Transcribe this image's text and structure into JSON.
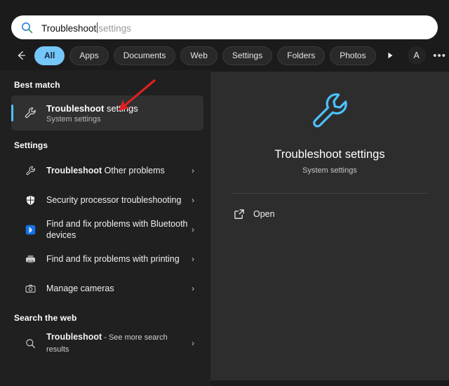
{
  "search": {
    "icon": "search-icon",
    "query": "Troubleshoot",
    "autocomplete_suggestion": "settings",
    "placeholder": "Search"
  },
  "filters": {
    "back_icon": "back-arrow-icon",
    "tabs": [
      {
        "label": "All",
        "active": true
      },
      {
        "label": "Apps",
        "active": false
      },
      {
        "label": "Documents",
        "active": false
      },
      {
        "label": "Web",
        "active": false
      },
      {
        "label": "Settings",
        "active": false
      },
      {
        "label": "Folders",
        "active": false
      },
      {
        "label": "Photos",
        "active": false
      }
    ],
    "more_icon": "play-triangle-icon",
    "account_label": "A",
    "overflow_label": "•••",
    "copilot_icon": "copilot-icon"
  },
  "best_match": {
    "section_title": "Best match",
    "icon": "wrench-icon",
    "title_bold": "Troubleshoot",
    "title_rest": " settings",
    "subtitle": "System settings"
  },
  "settings_section": {
    "section_title": "Settings",
    "items": [
      {
        "icon": "wrench-icon",
        "bold": "Troubleshoot",
        "rest": " Other problems",
        "chevron": "›"
      },
      {
        "icon": "shield-icon",
        "bold": "",
        "rest": "Security processor troubleshooting",
        "chevron": "›"
      },
      {
        "icon": "bluetooth-icon",
        "bold": "",
        "rest": "Find and fix problems with Bluetooth devices",
        "chevron": "›"
      },
      {
        "icon": "printer-icon",
        "bold": "",
        "rest": "Find and fix problems with printing",
        "chevron": "›"
      },
      {
        "icon": "camera-icon",
        "bold": "",
        "rest": "Manage cameras",
        "chevron": "›"
      }
    ]
  },
  "web_section": {
    "section_title": "Search the web",
    "item": {
      "icon": "search-icon",
      "bold": "Troubleshoot",
      "rest": " - See more search results",
      "chevron": "›"
    }
  },
  "preview": {
    "icon": "wrench-icon-large",
    "title": "Troubleshoot settings",
    "subtitle": "System settings",
    "action_icon": "external-link-icon",
    "action_label": "Open"
  },
  "annotation": {
    "type": "red-arrow",
    "color": "#e02020"
  },
  "colors": {
    "accent": "#4cc2ff",
    "active_chip": "#74c7f7",
    "left_panel_bg": "#202020",
    "right_panel_bg": "#2d2d2d",
    "window_bg": "#1b1b1b",
    "annotation_red": "#e02020"
  }
}
